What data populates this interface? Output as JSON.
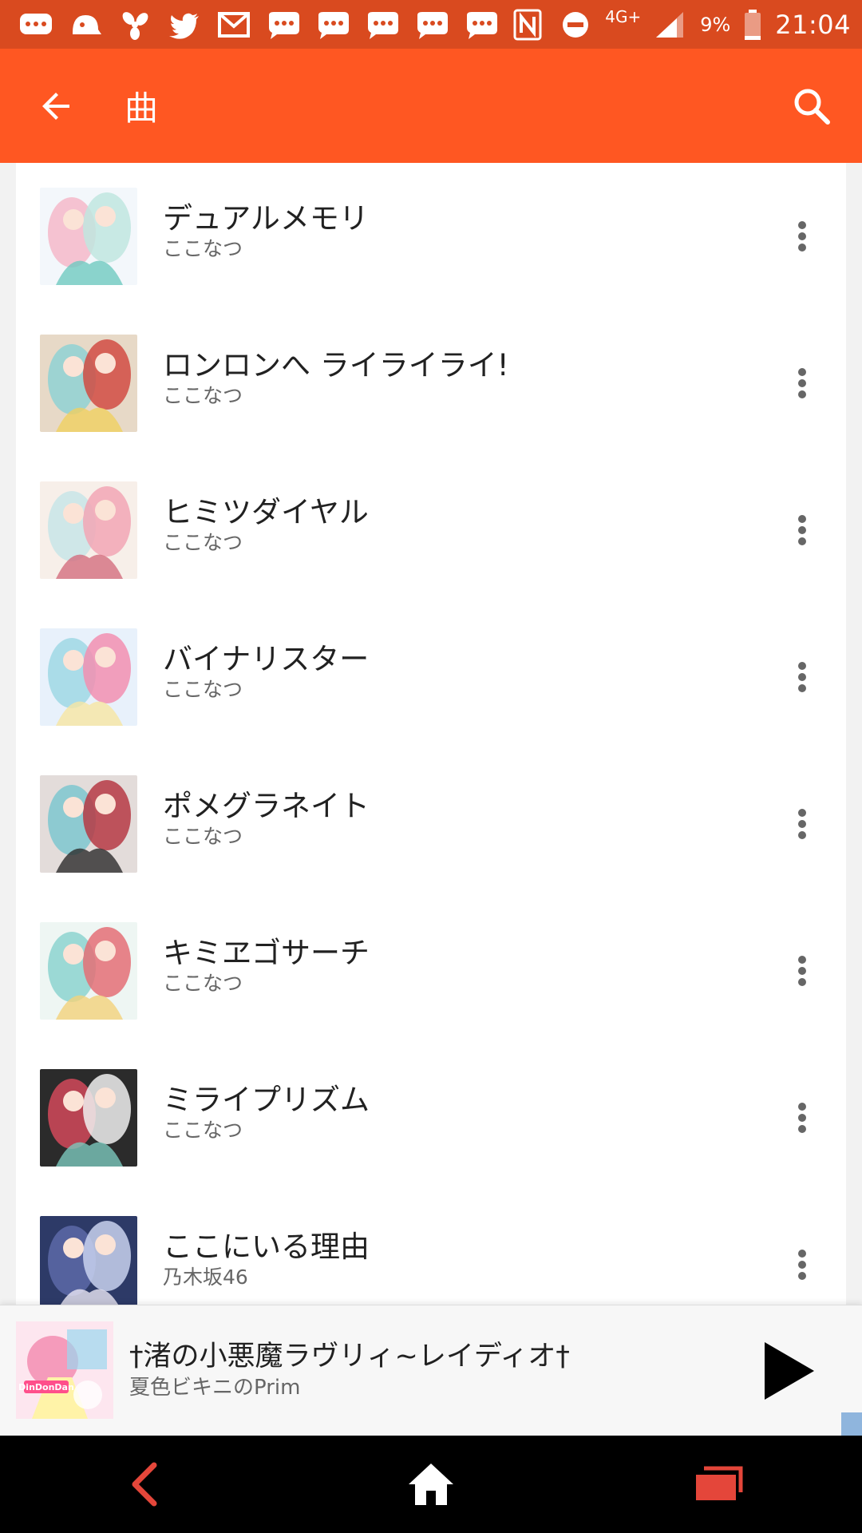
{
  "status_bar": {
    "notification_icons": [
      "chat-bubble-icon",
      "ghost-icon",
      "pinwheel-icon",
      "twitter-icon",
      "gmail-icon",
      "message-icon",
      "message-icon",
      "message-icon",
      "message-icon",
      "message-icon"
    ],
    "network": "4G+",
    "battery": "9%",
    "time": "21:04"
  },
  "app_bar": {
    "title": "曲"
  },
  "songs": [
    {
      "title": "デュアルメモリ",
      "artist": "ここなつ",
      "art_colors": [
        "#f3f7fb",
        "#bfe6df",
        "#f4b8c9",
        "#6fc9c0"
      ]
    },
    {
      "title": "ロンロンへ ライライライ!",
      "artist": "ここなつ",
      "art_colors": [
        "#e7d9c7",
        "#d14b43",
        "#8fd1d3",
        "#f0d060"
      ]
    },
    {
      "title": "ヒミツダイヤル",
      "artist": "ここなつ",
      "art_colors": [
        "#f7efe9",
        "#f2a6b5",
        "#c8e5e8",
        "#d36e7e"
      ]
    },
    {
      "title": "バイナリスター",
      "artist": "ここなつ",
      "art_colors": [
        "#e8f1fb",
        "#f28fb0",
        "#9fd8e4",
        "#f6e6a2"
      ]
    },
    {
      "title": "ポメグラネイト",
      "artist": "ここなつ",
      "art_colors": [
        "#e3dcda",
        "#b63a44",
        "#7ec7cf",
        "#2c2c2c"
      ]
    },
    {
      "title": "キミヱゴサーチ",
      "artist": "ここなつ",
      "art_colors": [
        "#eef6f3",
        "#e46e76",
        "#8cd3cf",
        "#f2d27a"
      ]
    },
    {
      "title": "ミライプリズム",
      "artist": "ここなつ",
      "art_colors": [
        "#2b2b2b",
        "#f0f0f0",
        "#d2495a",
        "#7cc8bd"
      ]
    },
    {
      "title": "ここにいる理由",
      "artist": "乃木坂46",
      "art_colors": [
        "#2d3a67",
        "#c9d2ee",
        "#5d6aa8",
        "#eae7f4"
      ]
    }
  ],
  "now_playing": {
    "title": "†渚の小悪魔ラヴリィ~レイディオ†",
    "artist": "夏色ビキニのPrim",
    "art_colors": [
      "#fde6ef",
      "#f59bbb",
      "#9ad7f0",
      "#fff3a8"
    ],
    "art_label": "DinDonDan"
  },
  "colors": {
    "status_bar": "#d94a1f",
    "app_bar": "#ff5722",
    "nav_back": "#e4463a",
    "nav_recents": "#e4463a"
  }
}
